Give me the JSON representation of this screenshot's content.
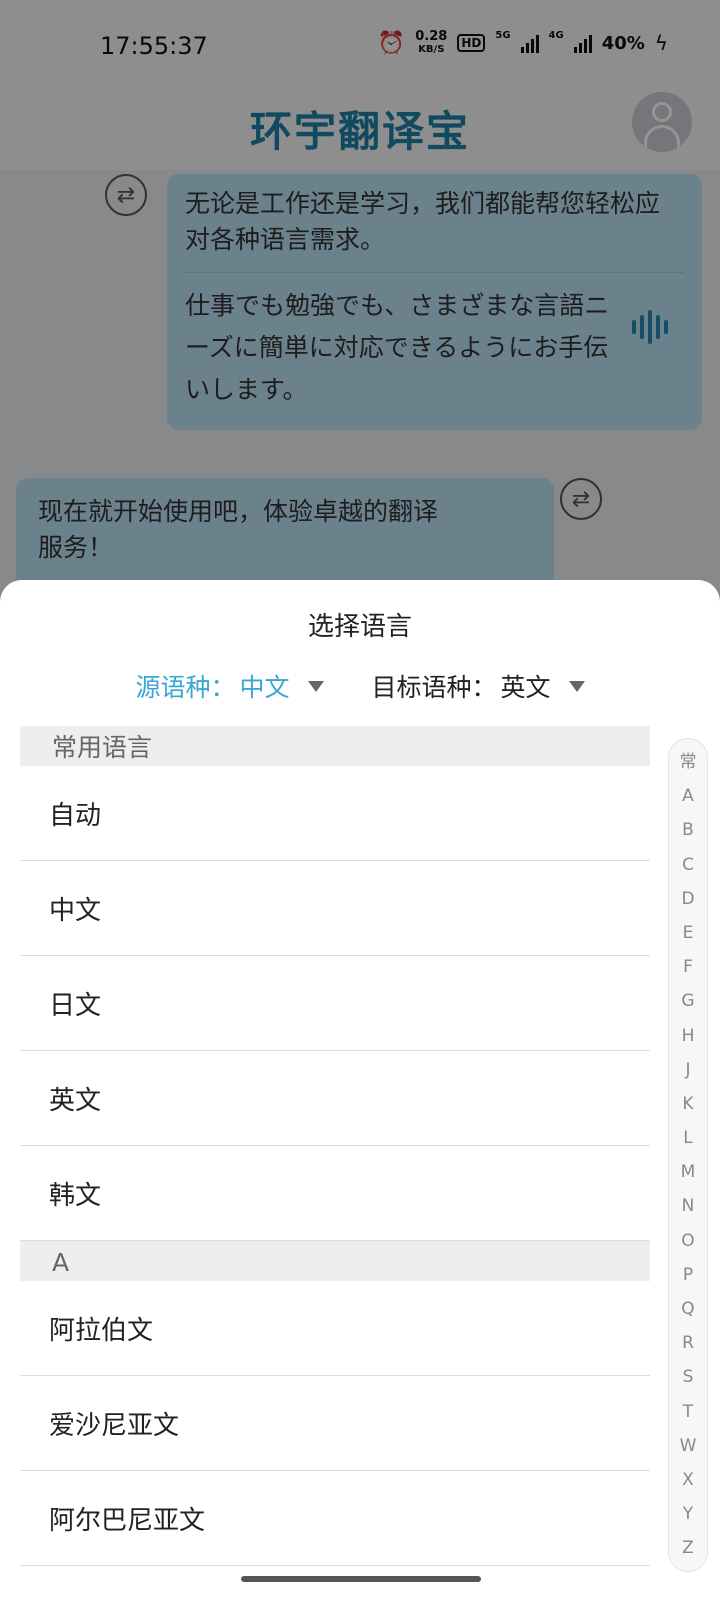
{
  "status_bar": {
    "time": "17:55:37",
    "net_speed_value": "0.28",
    "net_speed_unit": "KB/S",
    "hd_label": "HD",
    "sig1_tag": "5G",
    "sig2_tag": "4G",
    "battery": "40%"
  },
  "header": {
    "title": "环宇翻译宝"
  },
  "chat": {
    "msg1_source": "无论是工作还是学习，我们都能帮您轻松应对各种语言需求。",
    "msg1_translation": "仕事でも勉強でも、さまざまな言語ニーズに簡単に対応できるようにお手伝いします。",
    "msg2_source": "现在就开始使用吧，体验卓越的翻译服务！"
  },
  "sheet": {
    "title": "选择语言",
    "source_label": "源语种：",
    "source_value": "中文",
    "target_label": "目标语种：",
    "target_value": "英文"
  },
  "sections": [
    {
      "header": "常用语言",
      "items": [
        "自动",
        "中文",
        "日文",
        "英文",
        "韩文"
      ]
    },
    {
      "header": "A",
      "items": [
        "阿拉伯文",
        "爱沙尼亚文",
        "阿尔巴尼亚文"
      ]
    }
  ],
  "index_letters": [
    "常",
    "A",
    "B",
    "C",
    "D",
    "E",
    "F",
    "G",
    "H",
    "J",
    "K",
    "L",
    "M",
    "N",
    "O",
    "P",
    "Q",
    "R",
    "S",
    "T",
    "W",
    "X",
    "Y",
    "Z"
  ],
  "colors": {
    "accent": "#3aa7d3",
    "brand": "#1e7fa3",
    "bubble": "#b8e1f3"
  }
}
